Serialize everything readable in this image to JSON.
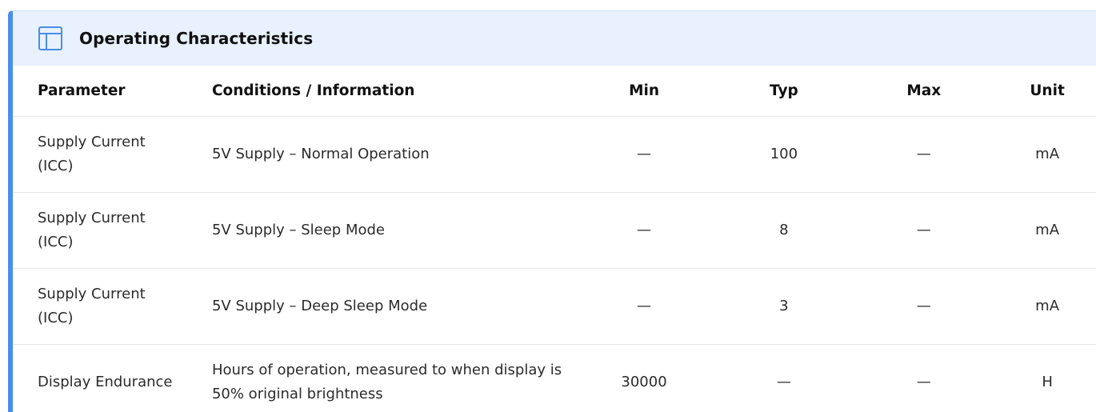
{
  "section": {
    "title": "Operating Characteristics",
    "icon": "table-icon",
    "accent_color": "#4a8eea",
    "header_bg": "#e8f1fd"
  },
  "table": {
    "headers": {
      "parameter": "Parameter",
      "conditions": "Conditions / Information",
      "min": "Min",
      "typ": "Typ",
      "max": "Max",
      "unit": "Unit"
    },
    "rows": [
      {
        "parameter": "Supply Current (ICC)",
        "conditions": "5V Supply – Normal Operation",
        "min": "—",
        "typ": "100",
        "max": "—",
        "unit": "mA"
      },
      {
        "parameter": "Supply Current (ICC)",
        "conditions": "5V Supply – Sleep Mode",
        "min": "—",
        "typ": "8",
        "max": "—",
        "unit": "mA"
      },
      {
        "parameter": "Supply Current (ICC)",
        "conditions": "5V Supply – Deep Sleep Mode",
        "min": "—",
        "typ": "3",
        "max": "—",
        "unit": "mA"
      },
      {
        "parameter": "Display Endurance",
        "conditions": "Hours of operation, measured to when display is 50% original brightness",
        "min": "30000",
        "typ": "—",
        "max": "—",
        "unit": "H"
      }
    ]
  }
}
